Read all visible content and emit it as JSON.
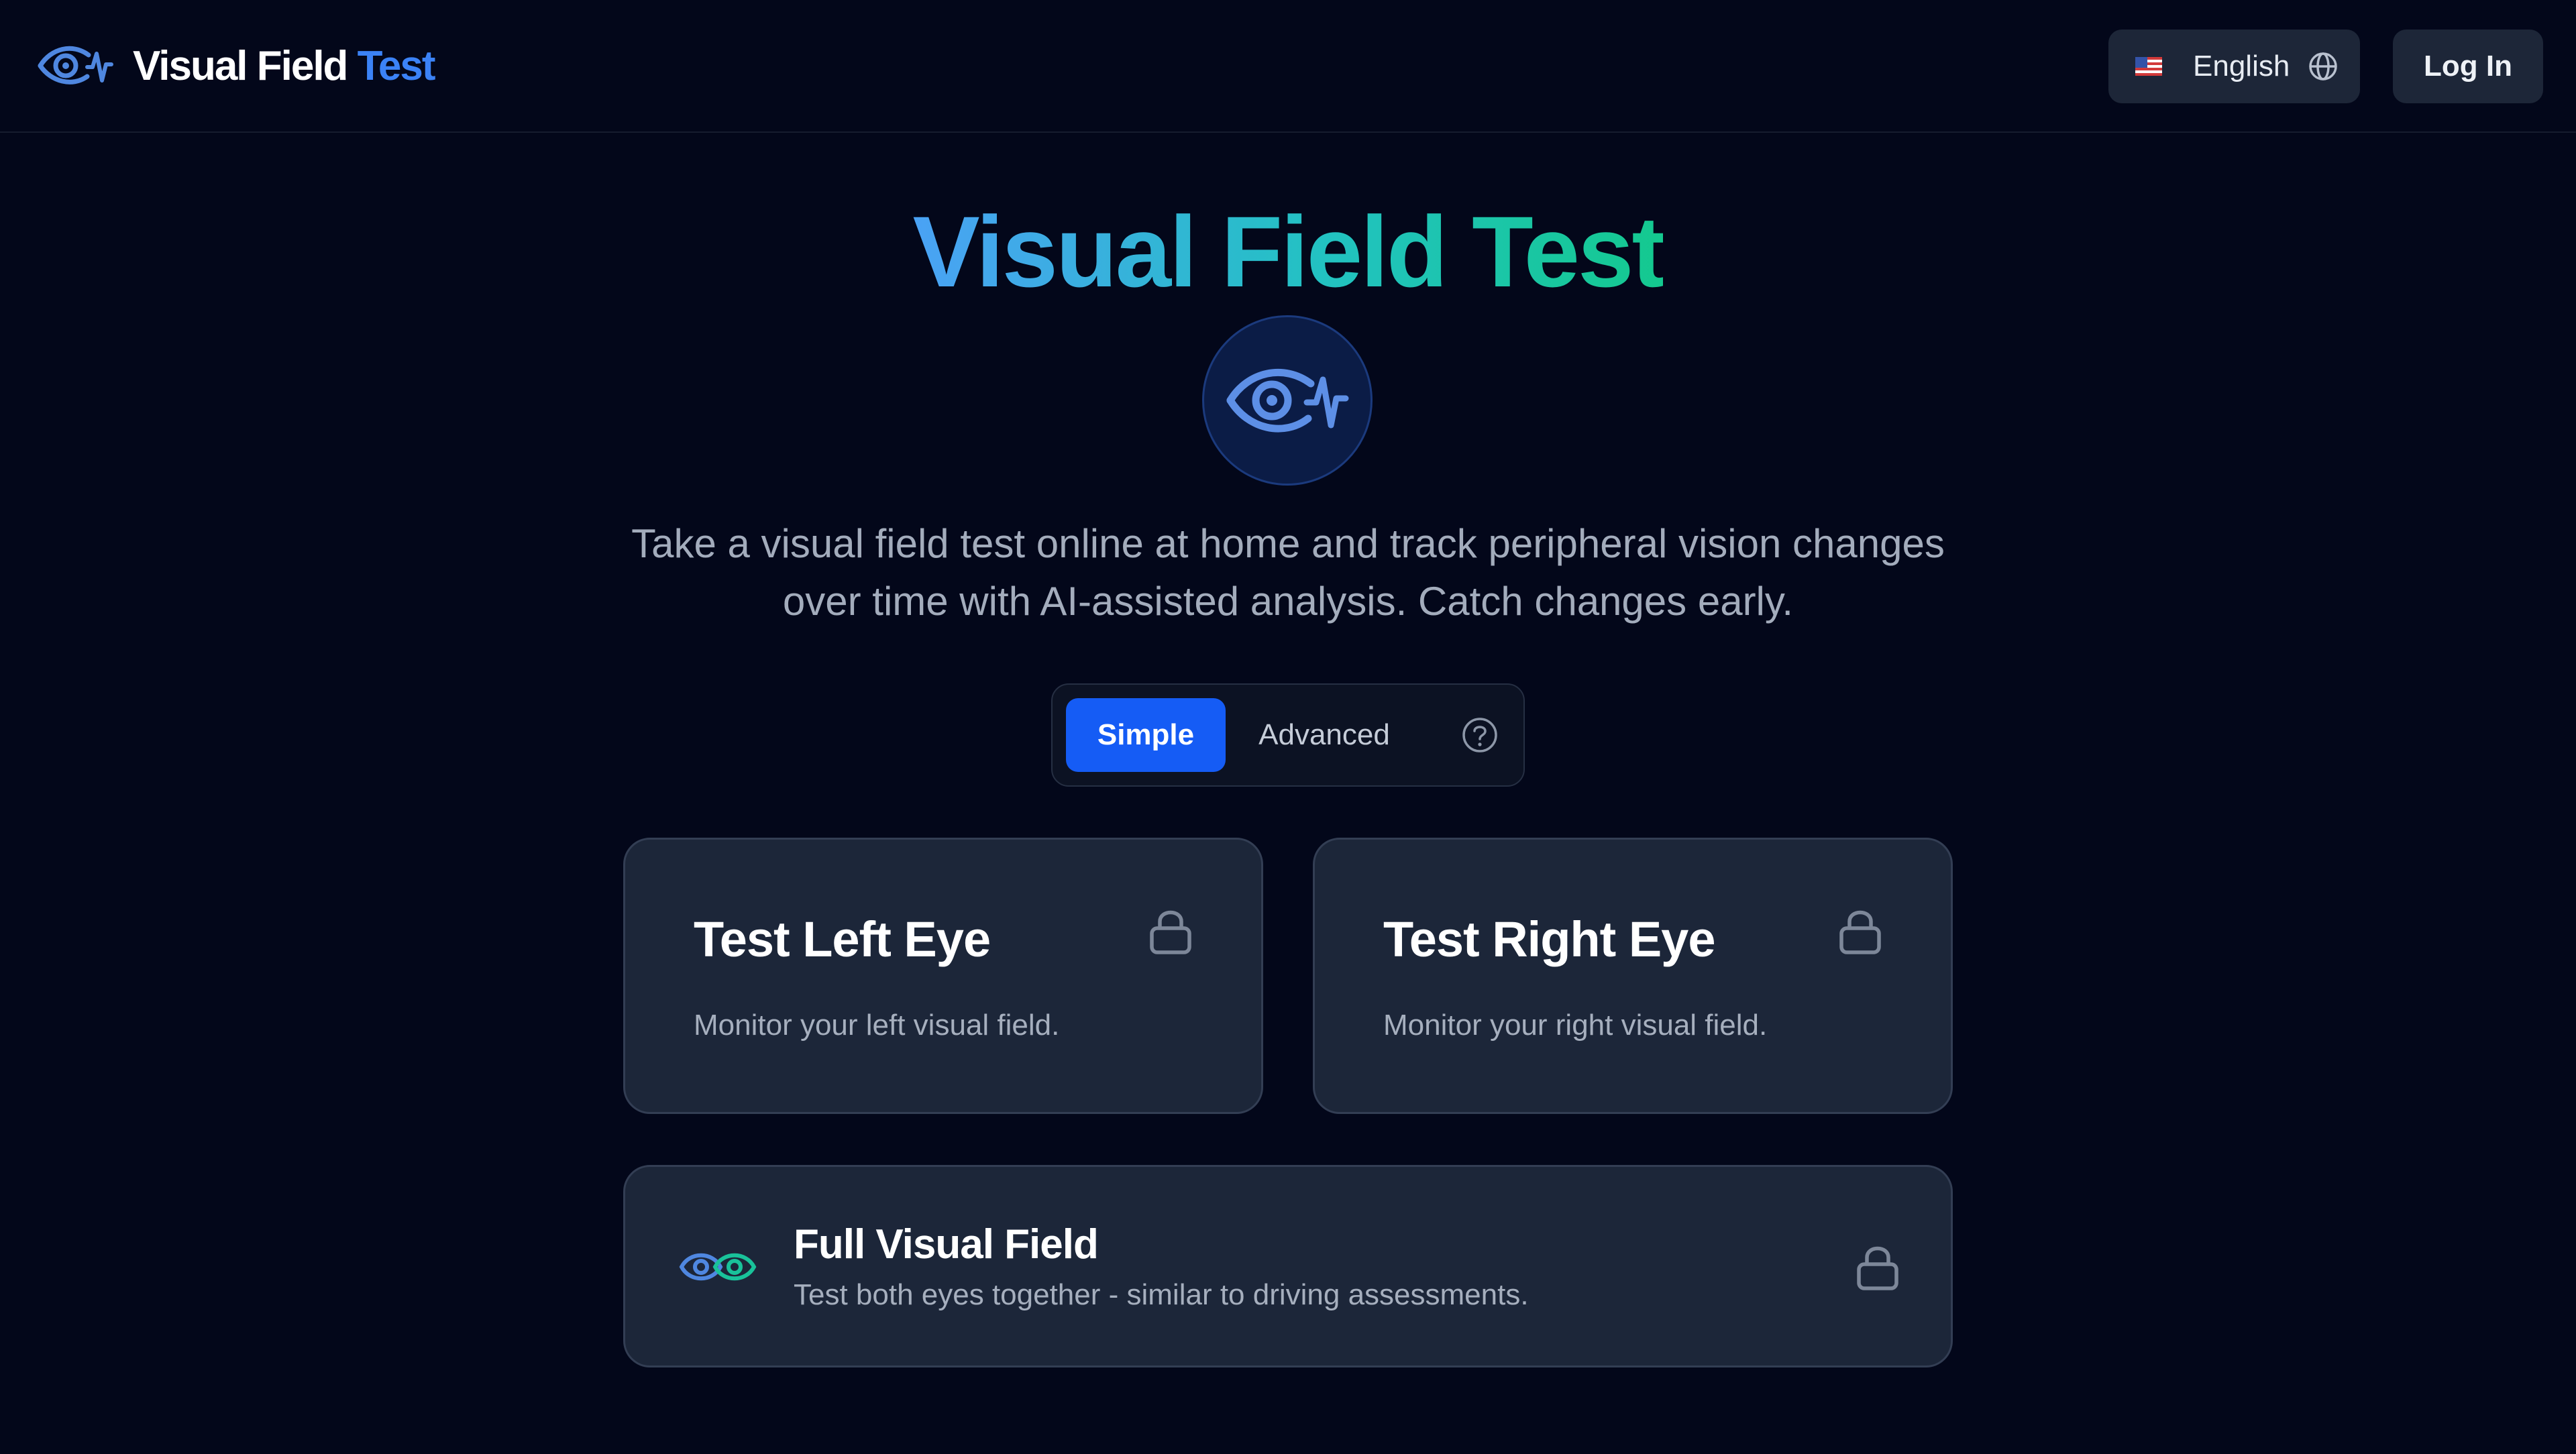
{
  "header": {
    "brand_main": "Visual Field",
    "brand_accent": "Test",
    "language_label": "English",
    "login_label": "Log In"
  },
  "hero": {
    "title": "Visual Field Test",
    "subtitle_line1": "Take a visual field test online at home and track peripheral vision changes",
    "subtitle_line2": "over time with AI-assisted analysis. Catch changes early."
  },
  "mode": {
    "options": [
      "Simple",
      "Advanced"
    ],
    "selected": "Simple"
  },
  "cards": {
    "left": {
      "title": "Test Left Eye",
      "description": "Monitor your left visual field."
    },
    "right": {
      "title": "Test Right Eye",
      "description": "Monitor your right visual field."
    },
    "full": {
      "title": "Full Visual Field",
      "description": "Test both eyes together - similar to driving assessments."
    }
  },
  "icons": {
    "brand": "eye-pulse-icon",
    "language_flag": "us-flag-icon",
    "language": "globe-icon",
    "help": "question-circle-icon",
    "locked": "lock-icon",
    "binocular": "both-eyes-icon"
  },
  "colors": {
    "background": "#03071a",
    "accent_blue": "#3b82f6",
    "selected_tab": "#155cf5",
    "card_background": "#1c2639",
    "title_gradient_start": "#4aa2f5",
    "title_gradient_end": "#14c98f"
  }
}
